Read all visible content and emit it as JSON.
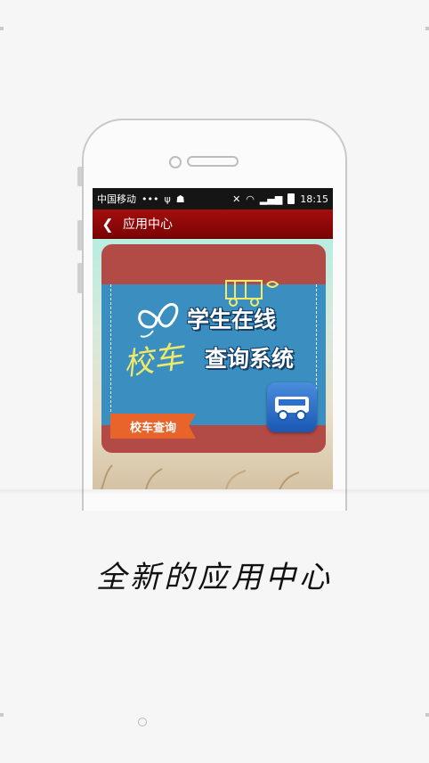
{
  "status_bar": {
    "carrier": "中国移动",
    "dots": "•••",
    "time": "18:15"
  },
  "title_bar": {
    "back_icon": "chevron-left-icon",
    "title": "应用中心"
  },
  "banner": {
    "line1": "学生在线",
    "line2": "查询系统",
    "script_word": "校车",
    "ribbon_label": "校车查询",
    "colors": {
      "card": "#b24a45",
      "banner": "#3b8fc0",
      "ribbon": "#e8642a",
      "app_icon": "#2a6fca"
    }
  },
  "caption": "全新的应用中心"
}
